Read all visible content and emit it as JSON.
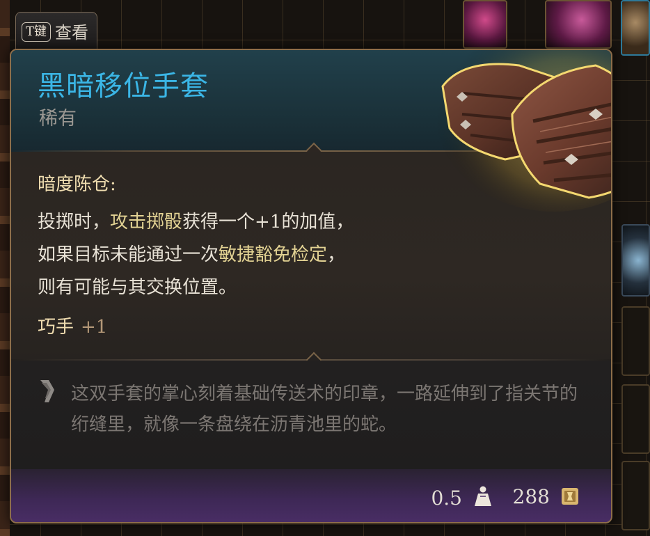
{
  "inspect_hint": {
    "key": "T键",
    "label": "查看"
  },
  "item": {
    "name": "黑暗移位手套",
    "rarity": "稀有",
    "name_color": "#3bb6e6",
    "art_icon": "leather-gloves-icon"
  },
  "ability": {
    "name": "暗度陈仓:",
    "desc_line1_a": "投掷时，",
    "desc_line1_highlight": "攻击掷骰",
    "desc_line1_b": "获得一个+1的加值，",
    "desc_line2_a": "如果目标未能通过一次",
    "desc_line2_highlight": "敏捷豁免检定",
    "desc_line2_b": "，",
    "desc_line3": "则有可能与其交换位置。",
    "highlight_color": "#e2d293"
  },
  "bonus": {
    "stat": "巧手",
    "value": "+1"
  },
  "lore": {
    "icon": "quote-feather-icon",
    "text": "这双手套的掌心刻着基础传送术的印章，一路延伸到了指关节的绗缝里，就像一条盘绕在沥青池里的蛇。"
  },
  "footer": {
    "weight": "0.5",
    "weight_icon": "weight-icon",
    "price": "288",
    "price_icon": "gold-coin-icon"
  }
}
